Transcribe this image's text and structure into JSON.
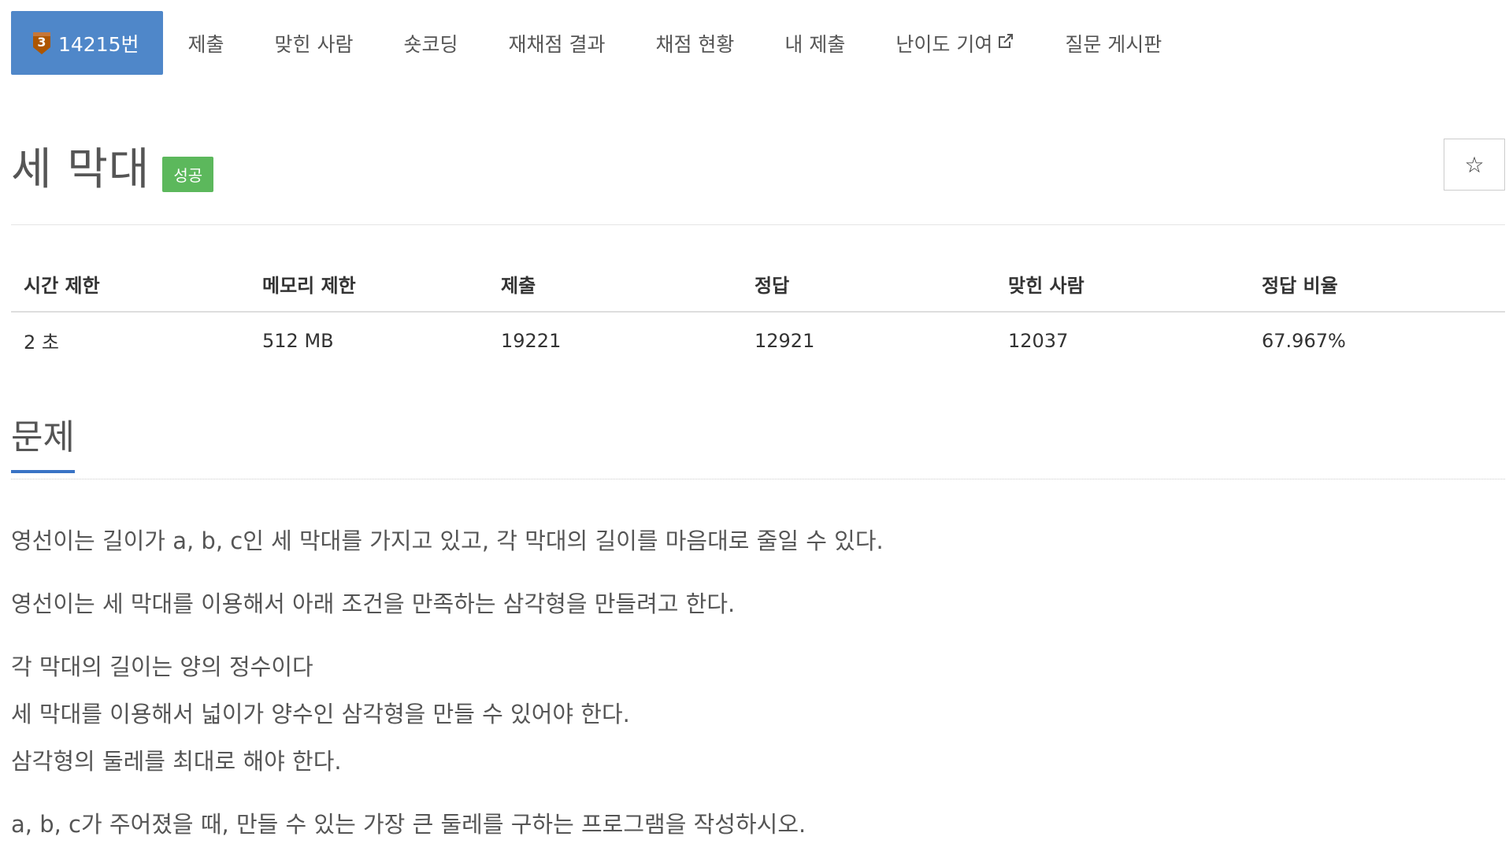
{
  "nav": {
    "tabs": [
      {
        "label": "14215번",
        "active": true,
        "tier": "3"
      },
      {
        "label": "제출"
      },
      {
        "label": "맞힌 사람"
      },
      {
        "label": "숏코딩"
      },
      {
        "label": "재채점 결과"
      },
      {
        "label": "채점 현황"
      },
      {
        "label": "내 제출"
      },
      {
        "label": "난이도 기여",
        "icon": "external-link-icon"
      },
      {
        "label": "질문 게시판"
      }
    ]
  },
  "problem": {
    "title": "세 막대",
    "status_badge": "성공",
    "star_icon": "star-icon"
  },
  "info_table": {
    "headers": [
      "시간 제한",
      "메모리 제한",
      "제출",
      "정답",
      "맞힌 사람",
      "정답 비율"
    ],
    "values": [
      "2 초",
      "512 MB",
      "19221",
      "12921",
      "12037",
      "67.967%"
    ]
  },
  "section": {
    "title": "문제"
  },
  "description": {
    "paragraphs": [
      "영선이는 길이가 a, b, c인 세 막대를 가지고 있고, 각 막대의 길이를 마음대로 줄일 수 있다.",
      "영선이는 세 막대를 이용해서 아래 조건을 만족하는 삼각형을 만들려고 한다.",
      "각 막대의 길이는 양의 정수이다",
      "세 막대를 이용해서 넓이가 양수인 삼각형을 만들 수 있어야 한다.",
      "삼각형의 둘레를 최대로 해야 한다.",
      "a, b, c가 주어졌을 때, 만들 수 있는 가장 큰 둘레를 구하는 프로그램을 작성하시오."
    ]
  },
  "colors": {
    "active_tab": "#4f87c9",
    "success_badge": "#5cb85c",
    "tier_bronze": "#ad5600",
    "section_underline": "#3973c5"
  }
}
